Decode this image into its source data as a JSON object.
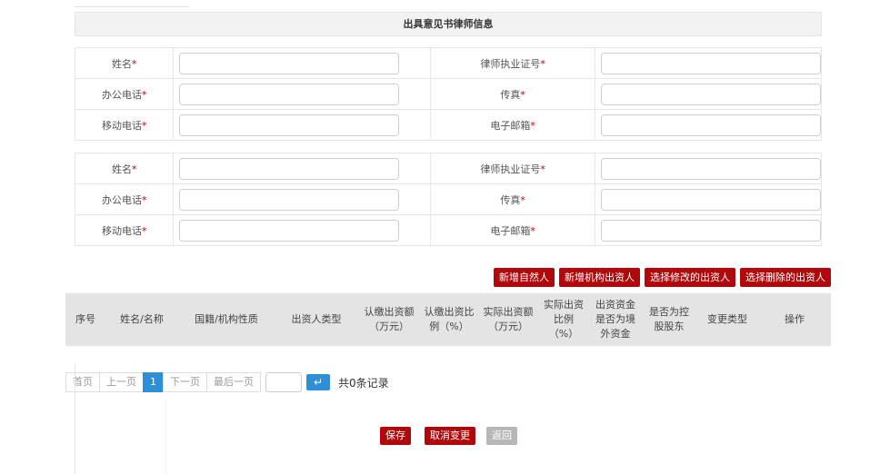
{
  "section": {
    "title": "出具意见书律师信息"
  },
  "lawyer_form_1": {
    "name_label": "姓名",
    "license_label": "律师执业证号",
    "office_phone_label": "办公电话",
    "fax_label": "传真",
    "mobile_label": "移动电话",
    "email_label": "电子邮箱",
    "required_mark": "*"
  },
  "lawyer_form_2": {
    "name_label": "姓名",
    "license_label": "律师执业证号",
    "office_phone_label": "办公电话",
    "fax_label": "传真",
    "mobile_label": "移动电话",
    "email_label": "电子邮箱",
    "required_mark": "*"
  },
  "actions": {
    "add_person": "新增自然人",
    "add_org": "新增机构出资人",
    "select_modify": "选择修改的出资人",
    "select_delete": "选择删除的出资人"
  },
  "table": {
    "headers": [
      "序号",
      "姓名/名称",
      "国籍/机构性质",
      "出资人类型",
      "认缴出资额\n（万元）",
      "认缴出资比\n例（%）",
      "实际出资额\n（万元）",
      "实际出资\n比例\n（%）",
      "出资资金\n是否为境\n外资金",
      "是否为控\n股股东",
      "变更类型",
      "操作"
    ]
  },
  "pager": {
    "first": "首页",
    "prev": "上一页",
    "current": "1",
    "next": "下一页",
    "last": "最后一页",
    "go": "↵",
    "total": "共0条记录"
  },
  "footer": {
    "save": "保存",
    "cancel_change": "取消变更",
    "back": "返回"
  },
  "colors": {
    "accent_red": "#b0080b",
    "accent_blue": "#2e8fd6",
    "disabled_gray": "#b7b7b7"
  }
}
